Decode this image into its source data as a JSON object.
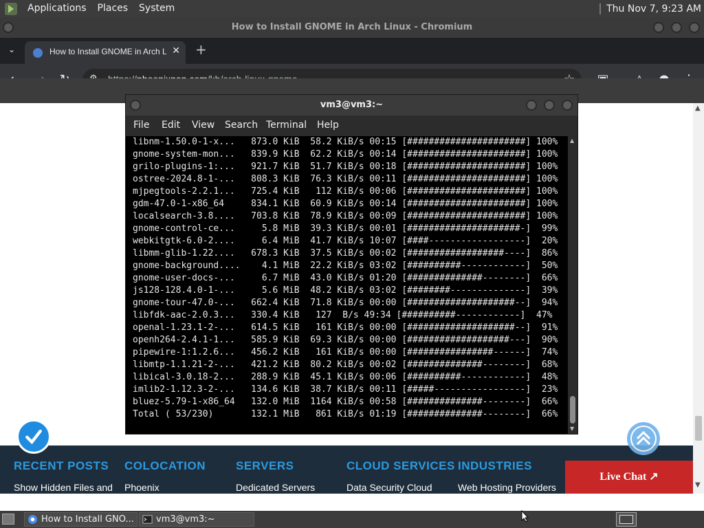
{
  "top_panel": {
    "menus": [
      "Applications",
      "Places",
      "System"
    ],
    "clock": "Thu Nov 7,  9:23 AM"
  },
  "browser": {
    "window_title": "How to Install GNOME in Arch Linux - Chromium",
    "tab_title": "How to Install GNOME in Arch Linux - phoenixNAP",
    "tab_close": "✕",
    "new_tab": "+",
    "url_prefix": "https://",
    "url_host": "phoenixnap.com",
    "url_path": "/kb/arch-linux-gnome"
  },
  "terminal": {
    "title": "vm3@vm3:~",
    "menus": [
      "File",
      "Edit",
      "View",
      "Search",
      "Terminal",
      "Help"
    ],
    "lines": [
      "libnm-1.50.0-1-x...   873.0 KiB  58.2 KiB/s 00:15 [######################] 100%",
      "gnome-system-mon...   839.9 KiB  62.2 KiB/s 00:14 [######################] 100%",
      "grilo-plugins-1:...   921.7 KiB  51.7 KiB/s 00:18 [######################] 100%",
      "ostree-2024.8-1-...   808.3 KiB  76.3 KiB/s 00:11 [######################] 100%",
      "mjpegtools-2.2.1...   725.4 KiB   112 KiB/s 00:06 [######################] 100%",
      "gdm-47.0-1-x86_64     834.1 KiB  60.9 KiB/s 00:14 [######################] 100%",
      "localsearch-3.8....   703.8 KiB  78.9 KiB/s 00:09 [######################] 100%",
      "gnome-control-ce...     5.8 MiB  39.3 KiB/s 00:01 [#####################-]  99%",
      "webkitgtk-6.0-2....     6.4 MiB  41.7 KiB/s 10:07 [####------------------]  20%",
      "libmm-glib-1.22....   678.3 KiB  37.5 KiB/s 00:02 [##################----]  86%",
      "gnome-background....    4.1 MiB  22.2 KiB/s 03:02 [##########------------]  50%",
      "gnome-user-docs-...     6.7 MiB  43.0 KiB/s 01:20 [##############--------]  66%",
      "js128-128.4.0-1-...     5.6 MiB  48.2 KiB/s 03:02 [########--------------]  39%",
      "gnome-tour-47.0-...   662.4 KiB  71.8 KiB/s 00:00 [####################--]  94%",
      "libfdk-aac-2.0.3...   330.4 KiB   127  B/s 49:34 [##########------------]  47%",
      "openal-1.23.1-2-...   614.5 KiB   161 KiB/s 00:00 [####################--]  91%",
      "openh264-2.4.1-1...   585.9 KiB  69.3 KiB/s 00:00 [###################---]  90%",
      "pipewire-1:1.2.6...   456.2 KiB   161 KiB/s 00:00 [################------]  74%",
      "libmtp-1.1.21-2-...   421.2 KiB  80.2 KiB/s 00:02 [##############--------]  68%",
      "libical-3.0.18-2...   288.9 KiB  45.1 KiB/s 00:06 [##########------------]  48%",
      "imlib2-1.12.3-2-...   134.6 KiB  38.7 KiB/s 00:11 [#####-----------------]  23%",
      "bluez-5.79-1-x86_64   132.0 MiB  1164 KiB/s 00:58 [##############--------]  66%",
      "Total ( 53/230)       132.1 MiB   861 KiB/s 01:19 [##############--------]  66%"
    ]
  },
  "footer": {
    "columns": [
      {
        "heading": "RECENT POSTS",
        "link": "Show Hidden Files and"
      },
      {
        "heading": "COLOCATION",
        "link": "Phoenix"
      },
      {
        "heading": "SERVERS",
        "link": "Dedicated Servers"
      },
      {
        "heading": "CLOUD SERVICES",
        "link": "Data Security Cloud"
      },
      {
        "heading": "INDUSTRIES",
        "link": "Web Hosting Providers"
      }
    ],
    "live_chat": "Live Chat ↗"
  },
  "taskbar": {
    "tasks": [
      "How to Install GNO...",
      "vm3@vm3:~"
    ]
  },
  "colors": {
    "panel": "#3c3c3c",
    "footer_bg": "#1e2d3b",
    "footer_heading": "#2c9ae0",
    "live_chat": "#c72727",
    "terminal_bg": "#000000"
  }
}
